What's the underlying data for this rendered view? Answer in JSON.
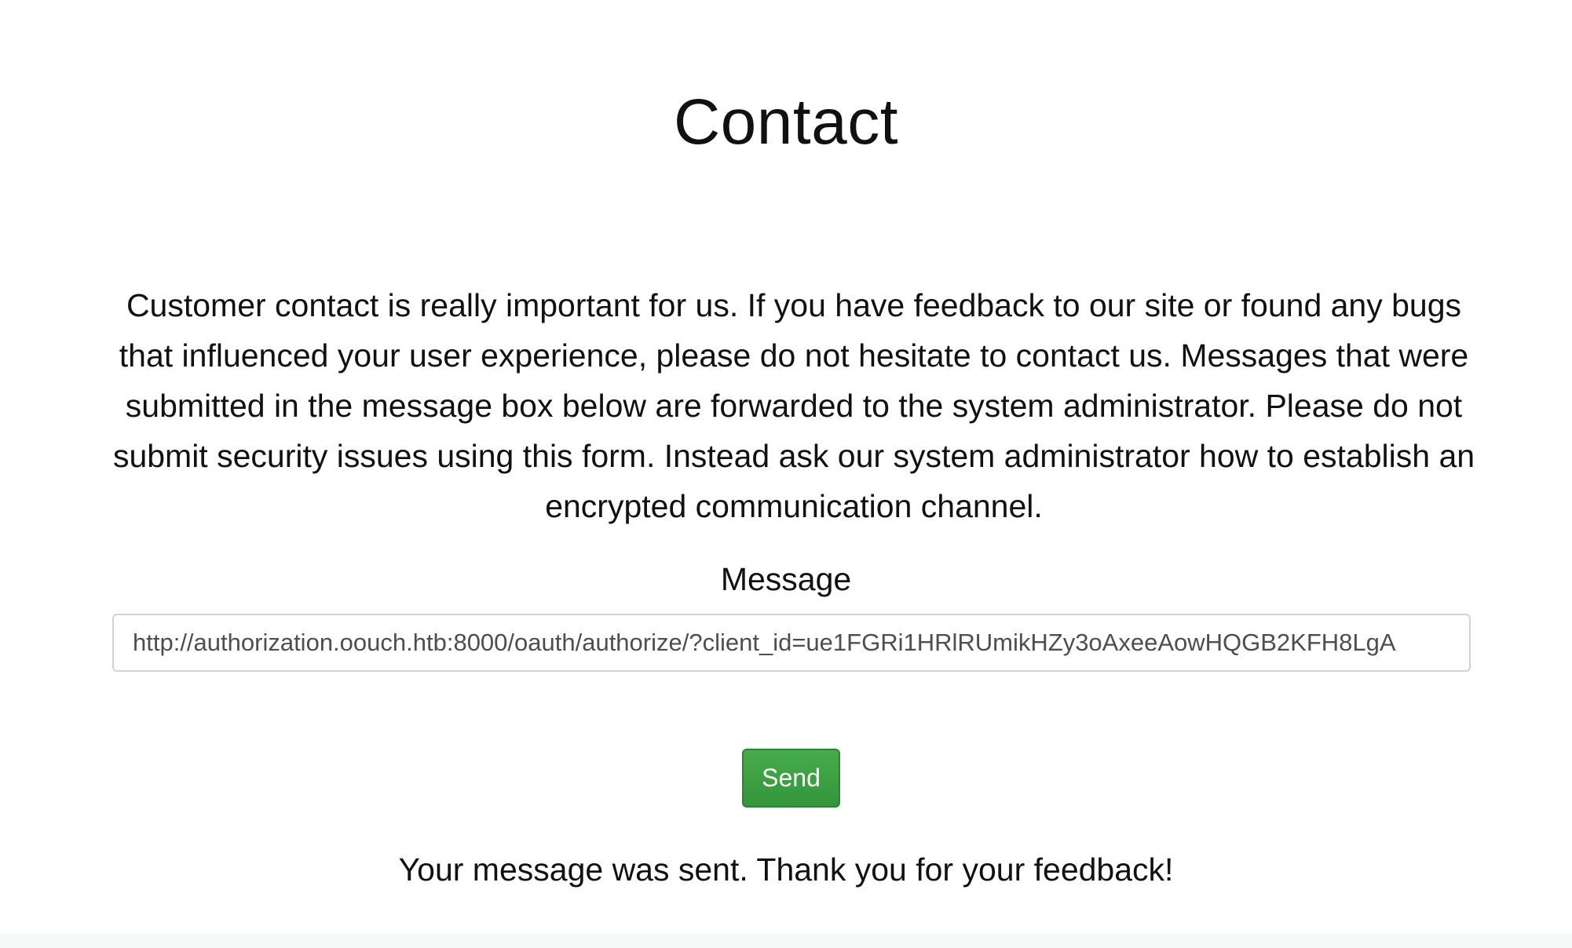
{
  "page": {
    "title": "Contact",
    "intro": "Customer contact is really important for us. If you have feedback to our site or found any bugs that influenced your user experience, please do not hesitate to contact us. Messages that were submitted in the message box below are forwarded to the system administrator. Please do not submit security issues using this form. Instead ask our system administrator how to establish an encrypted communication channel."
  },
  "form": {
    "message_label": "Message",
    "message_value": "http://authorization.oouch.htb:8000/oauth/authorize/?client_id=ue1FGRi1HRlRUmikHZy3oAxeeAowHQGB2KFH8LgA",
    "send_label": "Send"
  },
  "status": {
    "text": "Your message was sent. Thank you for your feedback!"
  },
  "colors": {
    "send_button": "#3d9f43",
    "input_border": "#cdd3d9",
    "text": "#111111"
  }
}
